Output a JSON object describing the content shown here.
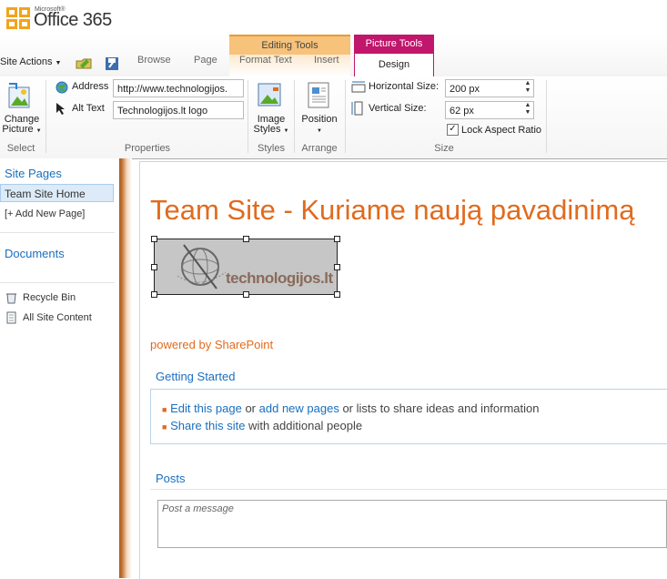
{
  "brand": {
    "microsoft": "Microsoft®",
    "product": "Office 365"
  },
  "tabs": {
    "site_actions": "Site Actions",
    "browse": "Browse",
    "page": "Page",
    "editing_tools": "Editing Tools",
    "format_text": "Format Text",
    "insert": "Insert",
    "picture_tools": "Picture Tools",
    "design": "Design"
  },
  "ribbon": {
    "change_picture": "Change",
    "change_picture2": "Picture",
    "address_label": "Address",
    "address_value": "http://www.technologijos.",
    "alt_text_label": "Alt Text",
    "alt_text_value": "Technologijos.lt logo",
    "image_styles": "Image",
    "image_styles2": "Styles",
    "position": "Position",
    "horizontal_size_label": "Horizontal Size:",
    "horizontal_size_value": "200 px",
    "vertical_size_label": "Vertical Size:",
    "vertical_size_value": "62 px",
    "lock_aspect": "Lock Aspect Ratio",
    "groups": {
      "select": "Select",
      "properties": "Properties",
      "styles": "Styles",
      "arrange": "Arrange",
      "size": "Size"
    }
  },
  "leftnav": {
    "site_pages": "Site Pages",
    "team_site_home": "Team Site Home",
    "add_new_page": "[+ Add New Page]",
    "documents": "Documents",
    "recycle_bin": "Recycle Bin",
    "all_site_content": "All Site Content"
  },
  "content": {
    "title": "Team Site - Kuriame naują pavadinimą",
    "logo_text": "technologijos.lt",
    "powered": "powered by SharePoint",
    "getting_started": "Getting Started",
    "item1_link1": "Edit this page",
    "item1_or": " or ",
    "item1_link2": "add new pages",
    "item1_rest": " or lists to share ideas and information",
    "item2_link": "Share this site",
    "item2_rest": " with additional people",
    "posts": "Posts",
    "post_placeholder": "Post a message"
  },
  "colors": {
    "accent_orange": "#e06b1e",
    "link_blue": "#1a6fbf",
    "picture_tools": "#c0166b",
    "editing_tools": "#f7b55a"
  }
}
